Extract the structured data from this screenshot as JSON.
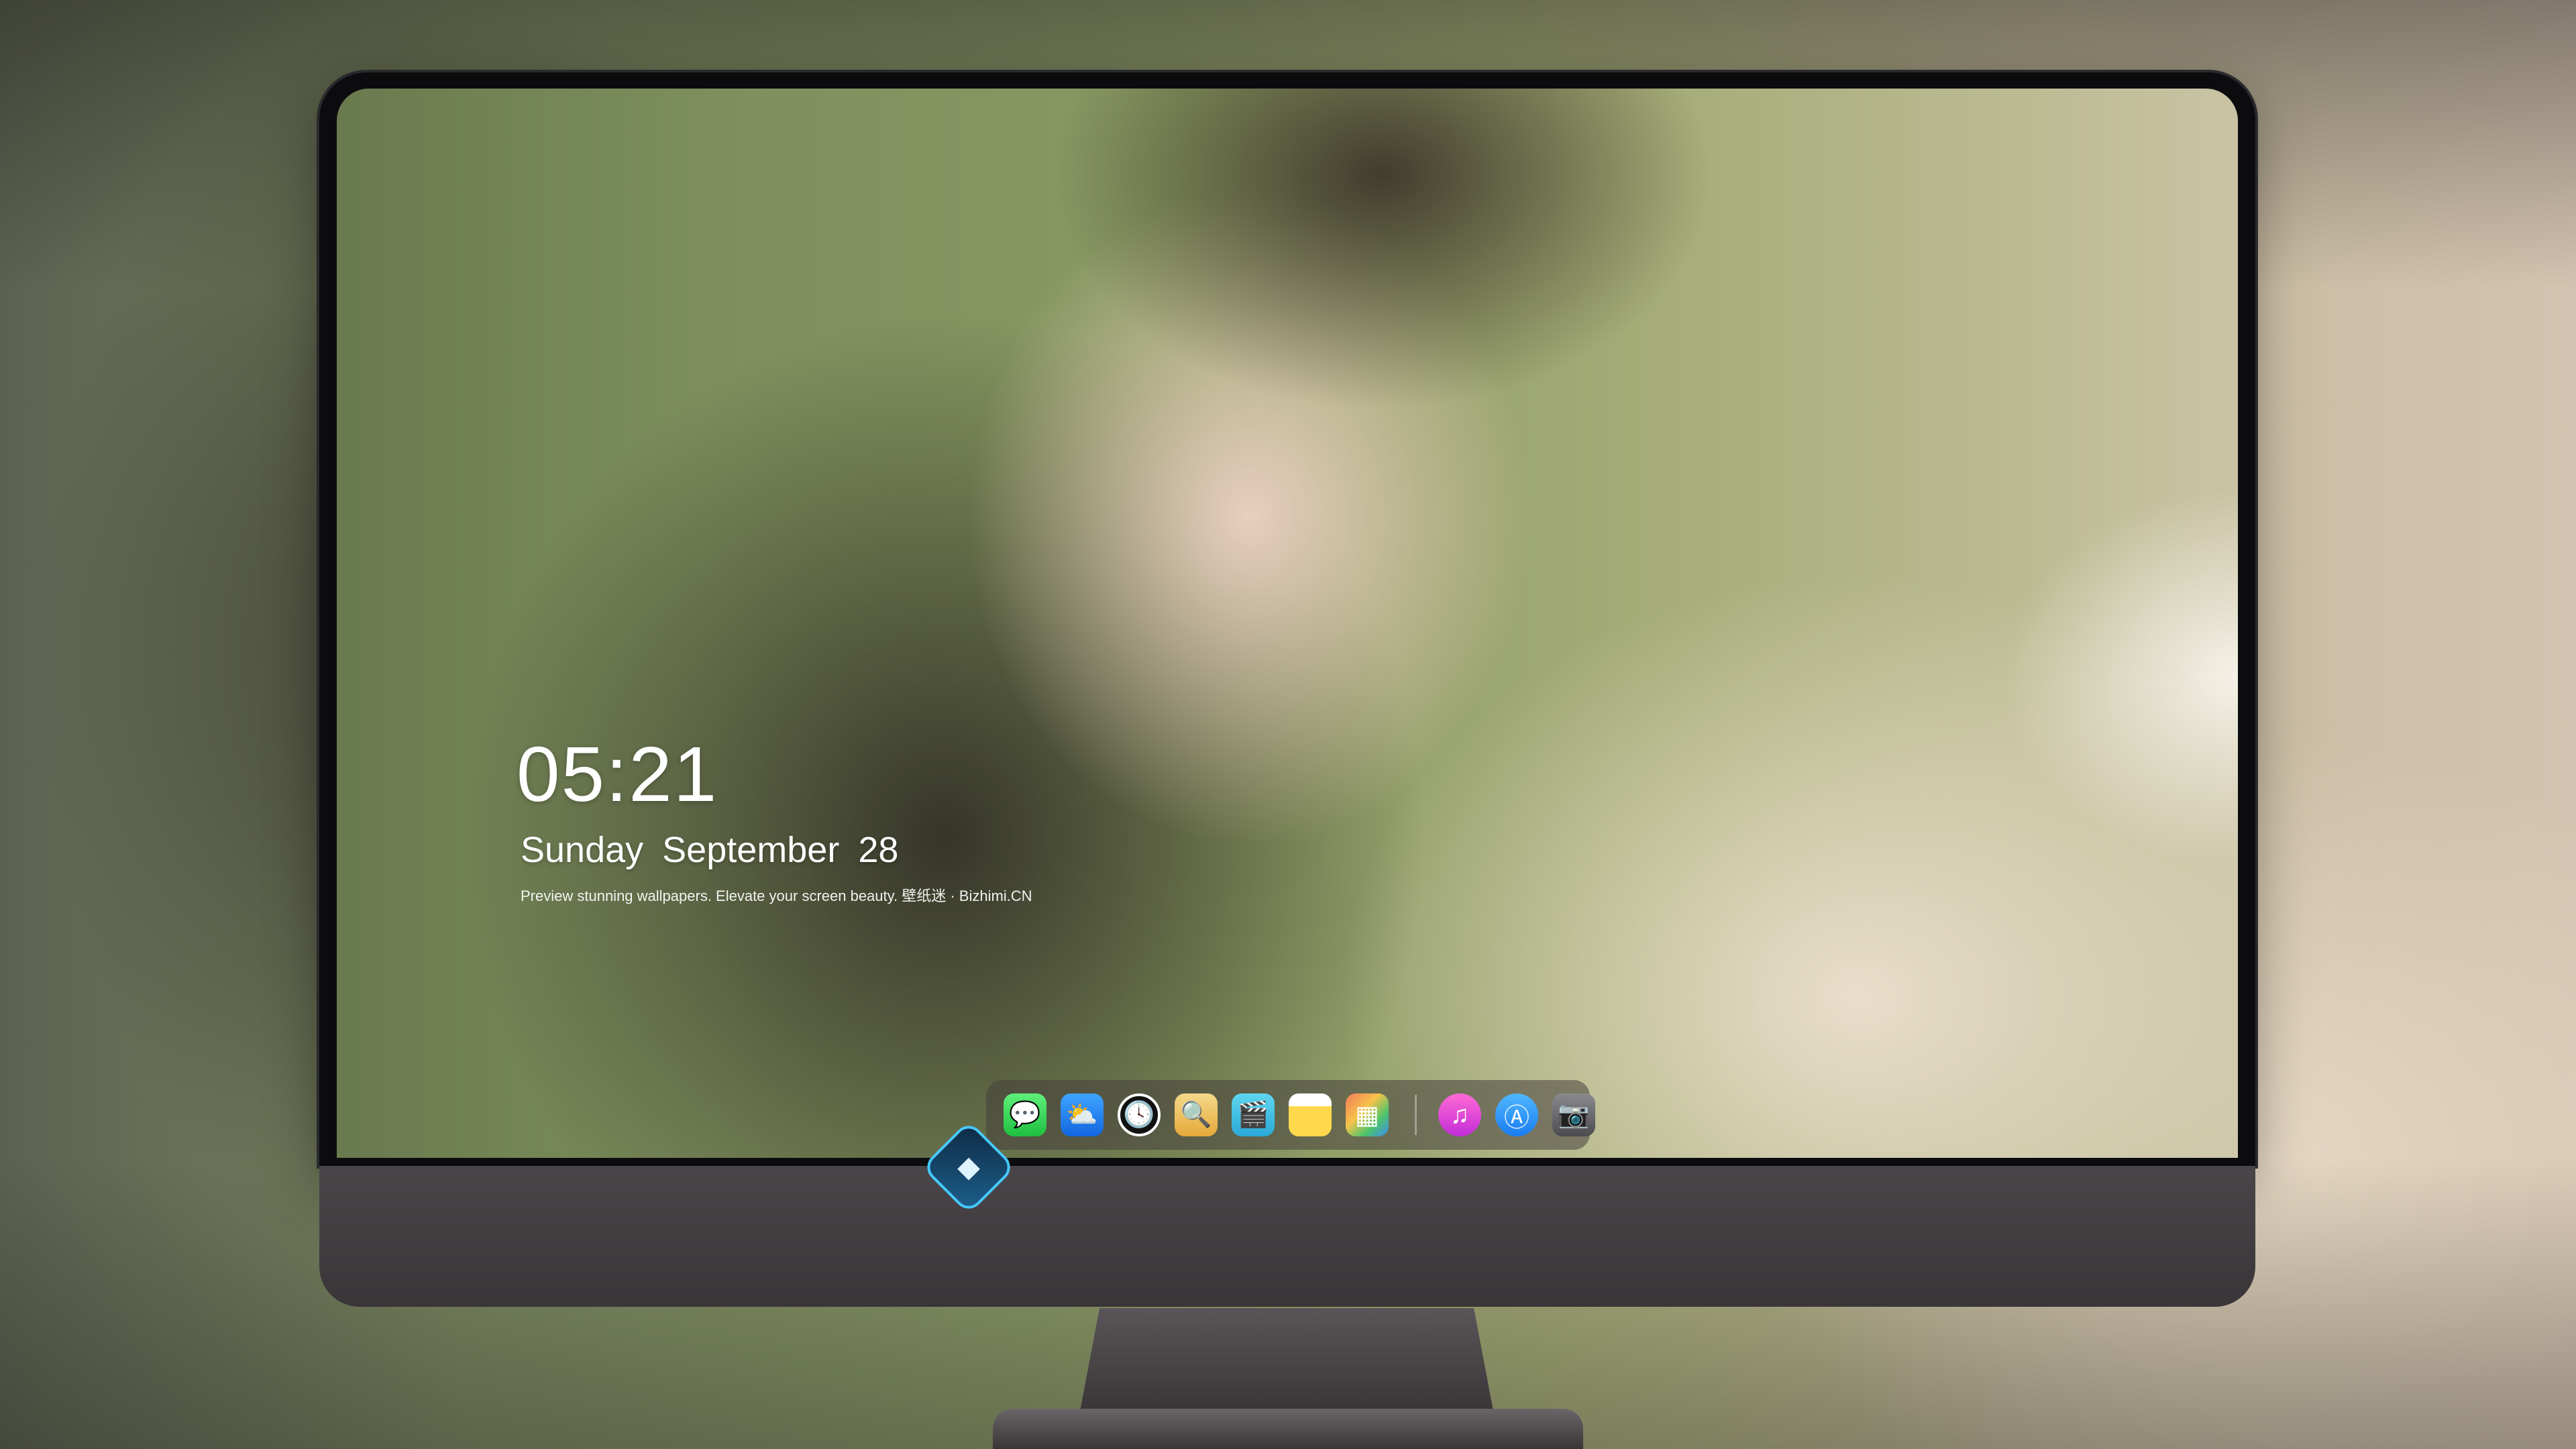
{
  "lockscreen": {
    "time": "05:21",
    "weekday": "Sunday",
    "month": "September",
    "day": "28",
    "tagline": "Preview stunning wallpapers. Elevate your screen beauty. 壁纸迷 · Bizhimi.CN"
  },
  "dock": {
    "items": [
      {
        "name": "messages-icon",
        "glyph": "💬"
      },
      {
        "name": "weather-icon",
        "glyph": "⛅"
      },
      {
        "name": "clock-icon",
        "glyph": "🕓"
      },
      {
        "name": "preview-icon",
        "glyph": "🔍"
      },
      {
        "name": "clips-icon",
        "glyph": "🎬"
      },
      {
        "name": "notes-icon",
        "glyph": ""
      },
      {
        "name": "photos-icon",
        "glyph": "▦"
      },
      {
        "name": "music-icon",
        "glyph": "♫"
      },
      {
        "name": "app-store-icon",
        "glyph": "Ⓐ"
      },
      {
        "name": "camera-icon",
        "glyph": "📷"
      }
    ]
  },
  "colors": {
    "bezel": "#0c0c0e",
    "chin": "#4a4548",
    "logo_accent": "#46c8ff"
  }
}
